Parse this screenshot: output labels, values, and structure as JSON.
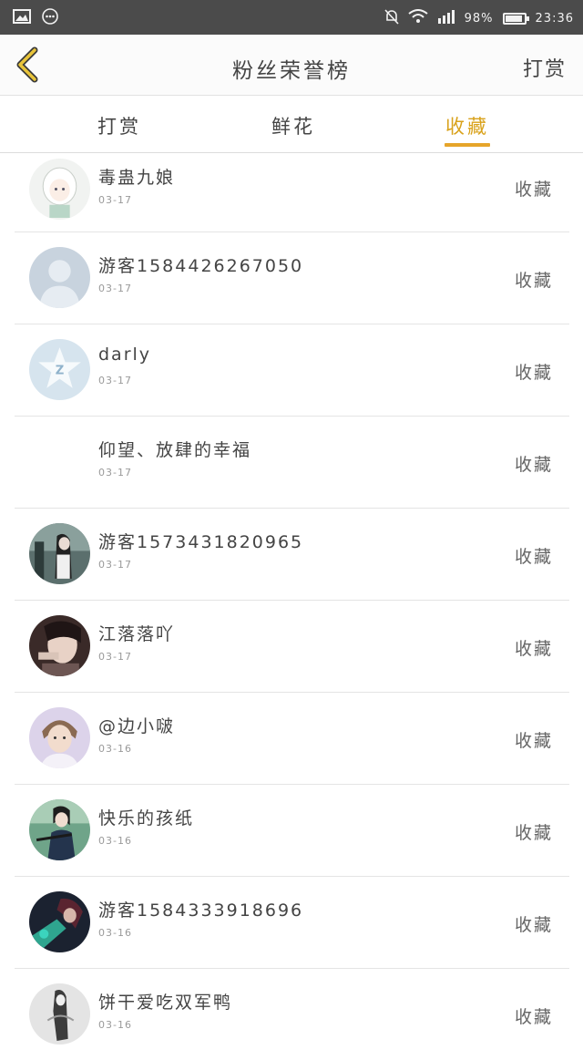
{
  "status_bar": {
    "left_icons": [
      "image-icon",
      "more-dots-icon"
    ],
    "right_icons": [
      "mute-icon",
      "wifi-icon",
      "signal-icon"
    ],
    "battery": "98%",
    "battery_level": 0.98,
    "time": "23:36"
  },
  "header": {
    "back_icon": "chevron-left-icon",
    "title": "粉丝荣誉榜",
    "action": "打赏",
    "accent_color": "#e6a52a"
  },
  "tabs": [
    {
      "label": "打赏",
      "active": false
    },
    {
      "label": "鲜花",
      "active": false
    },
    {
      "label": "收藏",
      "active": true
    }
  ],
  "rows": [
    {
      "name": "毒蛊九娘",
      "date": "03-17",
      "action": "收藏",
      "avatar": "anime-girl-avatar"
    },
    {
      "name": "游客1584426267050",
      "date": "03-17",
      "action": "收藏",
      "avatar": "default-person-avatar"
    },
    {
      "name": "darly",
      "date": "03-17",
      "action": "收藏",
      "avatar": "qq-star-avatar"
    },
    {
      "name": "仰望、放肆的幸福",
      "date": "03-17",
      "action": "收藏",
      "avatar": "blank-avatar"
    },
    {
      "name": "游客1573431820965",
      "date": "03-17",
      "action": "收藏",
      "avatar": "photo-avatar"
    },
    {
      "name": "江落落吖",
      "date": "03-17",
      "action": "收藏",
      "avatar": "photo-avatar"
    },
    {
      "name": "@边小啵",
      "date": "03-16",
      "action": "收藏",
      "avatar": "photo-avatar"
    },
    {
      "name": "快乐的孩纸",
      "date": "03-16",
      "action": "收藏",
      "avatar": "photo-avatar"
    },
    {
      "name": "游客1584333918696",
      "date": "03-16",
      "action": "收藏",
      "avatar": "photo-avatar"
    },
    {
      "name": "饼干爱吃双军鸭",
      "date": "03-16",
      "action": "收藏",
      "avatar": "photo-avatar"
    }
  ]
}
